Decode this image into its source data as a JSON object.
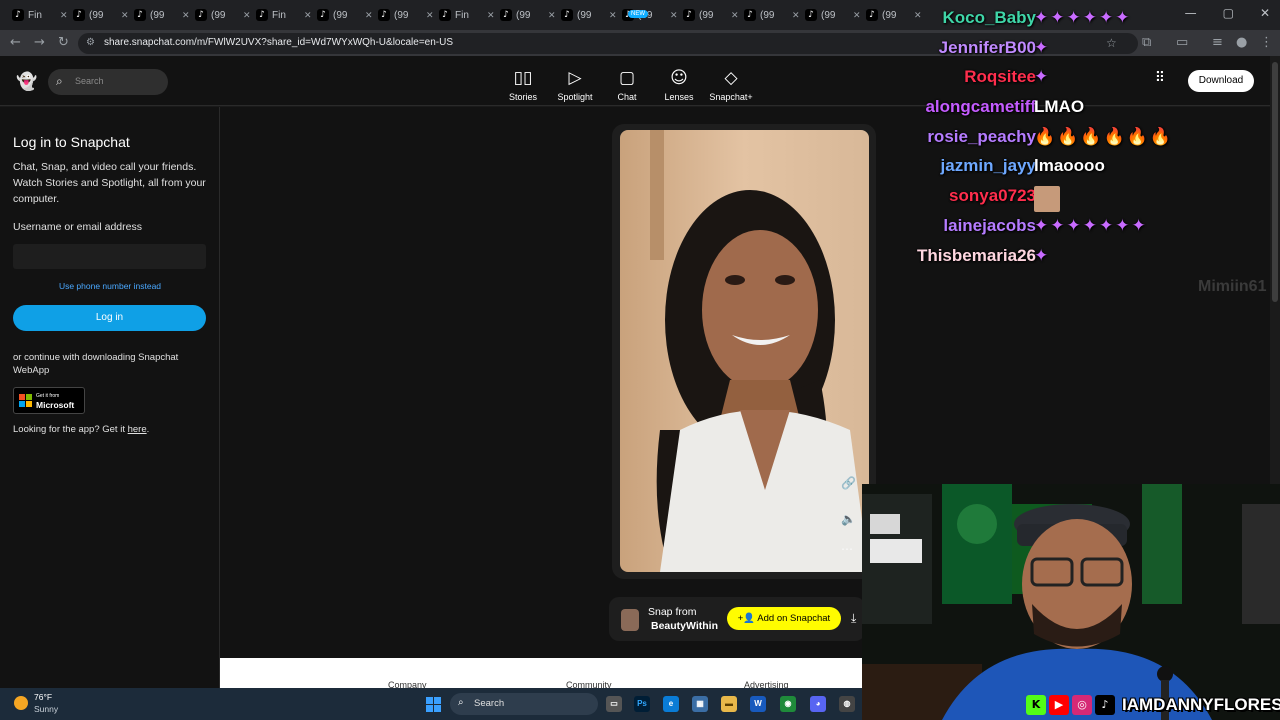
{
  "browser": {
    "tabs": [
      {
        "label": "Fin",
        "icon": "tiktok-icon"
      },
      {
        "label": "(99",
        "icon": "tiktok-icon"
      },
      {
        "label": "(99",
        "icon": "tiktok-icon"
      },
      {
        "label": "(99",
        "icon": "tiktok-icon"
      },
      {
        "label": "Fin",
        "icon": "tiktok-icon"
      },
      {
        "label": "(99",
        "icon": "tiktok-icon"
      },
      {
        "label": "(99",
        "icon": "tiktok-icon"
      },
      {
        "label": "Fin",
        "icon": "tiktok-icon"
      },
      {
        "label": "(99",
        "icon": "tiktok-icon"
      },
      {
        "label": "(99",
        "icon": "tiktok-icon"
      },
      {
        "label": "(99",
        "icon": "tiktok-icon"
      },
      {
        "label": "(99",
        "icon": "tiktok-icon"
      },
      {
        "label": "(99",
        "icon": "tiktok-icon"
      },
      {
        "label": "(99",
        "icon": "tiktok-icon"
      },
      {
        "label": "(99",
        "icon": "tiktok-icon"
      }
    ],
    "url": "share.snapchat.com/m/FWlW2UVX?share_id=Wd7WYxWQh-U&locale=en-US"
  },
  "snap_header": {
    "search_placeholder": "Search",
    "nav": [
      {
        "label": "Stories",
        "icon": "stories-icon"
      },
      {
        "label": "Spotlight",
        "icon": "spotlight-icon"
      },
      {
        "label": "Chat",
        "icon": "chat-icon"
      },
      {
        "label": "Lenses",
        "icon": "lenses-icon"
      },
      {
        "label": "Snapchat+",
        "icon": "snapchat-plus-icon"
      }
    ],
    "chat_badge": "NEW",
    "download_label": "Download"
  },
  "login": {
    "title": "Log in to Snapchat",
    "description": "Chat, Snap, and video call your friends. Watch Stories and Spotlight, all from your computer.",
    "username_label": "Username or email address",
    "username_value": "",
    "phone_link": "Use phone number instead",
    "login_button": "Log in",
    "continue_text": "or continue with downloading Snapchat WebApp",
    "ms_badge_line1": "Get it from",
    "ms_badge_line2": "Microsoft",
    "app_prefix": "Looking for the app? Get it ",
    "app_link": "here",
    "app_suffix": "."
  },
  "snap_viewer": {
    "from_label": "Snap from",
    "username": "BeautyWithin",
    "add_button": "Add on Snapchat"
  },
  "footer": {
    "headings": [
      "Company",
      "Community",
      "Advertising"
    ]
  },
  "taskbar": {
    "temperature": "76°F",
    "condition": "Sunny",
    "search_placeholder": "Search"
  },
  "stream_chat": [
    {
      "user": "Koco_Baby",
      "color": "#3fd6a8",
      "message": "",
      "emotes": 6
    },
    {
      "user": "JenniferB00",
      "color": "#c08aff",
      "message": "",
      "emotes": 1
    },
    {
      "user": "Roqsitee",
      "color": "#ff2e4d",
      "message": "",
      "emotes": 1
    },
    {
      "user": "alongcametiff",
      "color": "#c45cff",
      "message": "LMAO",
      "emotes": 0
    },
    {
      "user": "rosie_peachy",
      "color": "#b57cff",
      "message": "",
      "fires": 6
    },
    {
      "user": "jazmin_jayy",
      "color": "#6ea8ff",
      "message": "lmaoooo",
      "emotes": 0
    },
    {
      "user": "sonya0723",
      "color": "#ff2e4d",
      "message": "",
      "face": true
    },
    {
      "user": "lainejacobs",
      "color": "#b57cff",
      "message": "",
      "emotes": 7
    },
    {
      "user": "Thisbemaria26",
      "color": "#ffd6e0",
      "message": "",
      "emotes": 1
    }
  ],
  "fading_user": "Mimiin61",
  "stream_overlay": {
    "handle": "IAMDANNYFLORES"
  },
  "colors": {
    "snap_yellow": "#fffc00",
    "login_blue": "#0fa0e6",
    "emote_purple": "#c86bff"
  }
}
